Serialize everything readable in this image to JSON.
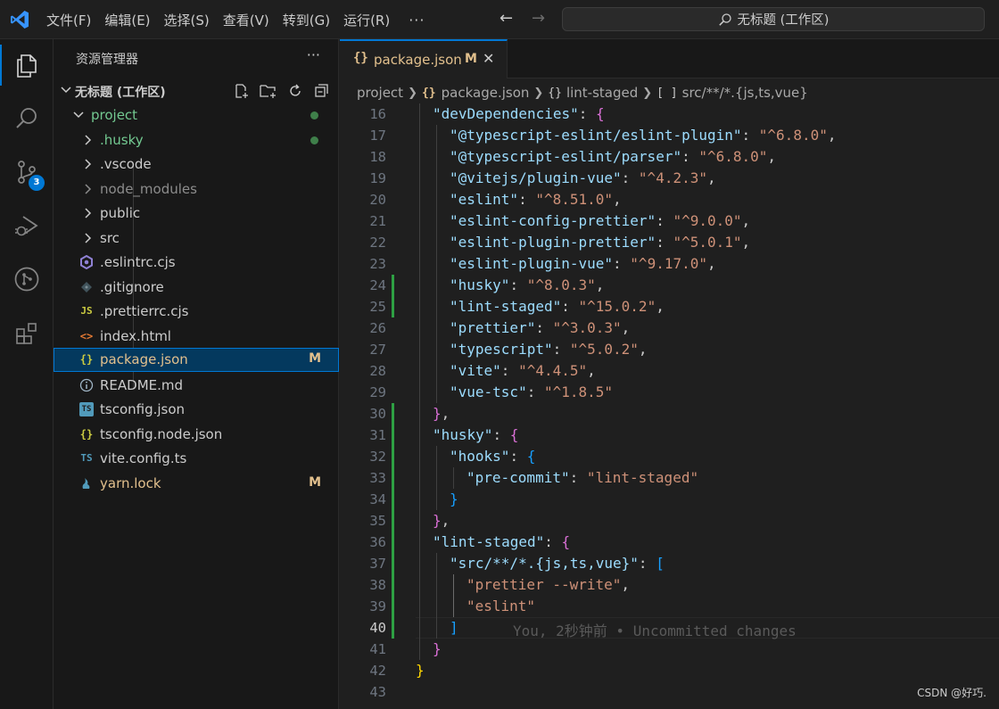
{
  "menu": {
    "items": [
      "文件(F)",
      "编辑(E)",
      "选择(S)",
      "查看(V)",
      "转到(G)",
      "运行(R)"
    ],
    "more": "···"
  },
  "search": {
    "text": "无标题 (工作区)"
  },
  "activity": {
    "scm_badge": "3"
  },
  "sidebar": {
    "title": "资源管理器",
    "more": "···",
    "workspace": "无标题 (工作区)",
    "items": [
      {
        "label": "project",
        "kind": "folder",
        "color": "#73c991",
        "dot": true
      },
      {
        "label": ".husky",
        "kind": "folder",
        "color": "#73c991",
        "dot": true
      },
      {
        "label": ".vscode",
        "kind": "folder",
        "color": "#cccccc"
      },
      {
        "label": "node_modules",
        "kind": "folder",
        "color": "#8c8c8c"
      },
      {
        "label": "public",
        "kind": "folder",
        "color": "#cccccc"
      },
      {
        "label": "src",
        "kind": "folder",
        "color": "#cccccc"
      },
      {
        "label": ".eslintrc.cjs",
        "kind": "file",
        "icon": "eslint-icon",
        "color": "#cccccc"
      },
      {
        "label": ".gitignore",
        "kind": "file",
        "icon": "git-icon",
        "color": "#cccccc"
      },
      {
        "label": ".prettierrc.cjs",
        "kind": "file",
        "icon": "js-icon",
        "color": "#cccccc"
      },
      {
        "label": "index.html",
        "kind": "file",
        "icon": "html-icon",
        "color": "#cccccc"
      },
      {
        "label": "package.json",
        "kind": "file",
        "icon": "json-icon",
        "color": "#e2c08d",
        "badge": "M"
      },
      {
        "label": "README.md",
        "kind": "file",
        "icon": "info-icon",
        "color": "#cccccc"
      },
      {
        "label": "tsconfig.json",
        "kind": "file",
        "icon": "ts-config-icon",
        "color": "#cccccc"
      },
      {
        "label": "tsconfig.node.json",
        "kind": "file",
        "icon": "json-icon",
        "color": "#cccccc"
      },
      {
        "label": "vite.config.ts",
        "kind": "file",
        "icon": "ts-icon",
        "color": "#cccccc"
      },
      {
        "label": "yarn.lock",
        "kind": "file",
        "icon": "yarn-icon",
        "color": "#e2c08d",
        "badge": "M"
      }
    ]
  },
  "tab": {
    "label": "package.json",
    "modified": "M",
    "close": "✕",
    "icon": "{}"
  },
  "breadcrumb": {
    "project": "project",
    "file": "package.json",
    "obj": "lint-staged",
    "arr": "src/**/*.{js,ts,vue}"
  },
  "code": {
    "line_numbers": [
      "16",
      "17",
      "18",
      "19",
      "20",
      "21",
      "22",
      "23",
      "24",
      "25",
      "26",
      "27",
      "28",
      "29",
      "30",
      "31",
      "32",
      "33",
      "34",
      "35",
      "36",
      "37",
      "38",
      "39",
      "40",
      "41",
      "42",
      "43"
    ],
    "current_line": "40",
    "blame": "You, 2秒钟前 • Uncommitted changes"
  },
  "watermark": "CSDN @好巧."
}
